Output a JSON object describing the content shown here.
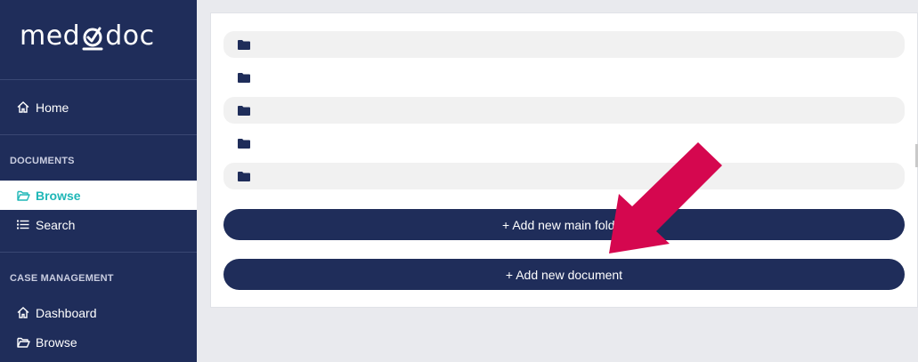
{
  "brand": {
    "logo_text_left": "med",
    "logo_text_right": "doc"
  },
  "sidebar": {
    "home": {
      "label": "Home",
      "icon": "home-icon"
    },
    "documents_section": "DOCUMENTS",
    "documents_items": [
      {
        "label": "Browse",
        "icon": "folder-open-icon",
        "active": true
      },
      {
        "label": "Search",
        "icon": "list-icon",
        "active": false
      }
    ],
    "case_section": "CASE MANAGEMENT",
    "case_items": [
      {
        "label": "Dashboard",
        "icon": "home-icon"
      },
      {
        "label": "Browse",
        "icon": "folder-open-icon"
      }
    ]
  },
  "main": {
    "folders": [
      {
        "name": ""
      },
      {
        "name": ""
      },
      {
        "name": ""
      },
      {
        "name": ""
      },
      {
        "name": ""
      }
    ],
    "add_main_folder_label": "+ Add new main folder",
    "add_document_label": "+ Add new document"
  },
  "colors": {
    "sidebar_bg": "#1f2d5a",
    "active_accent": "#1fb7b7",
    "button_bg": "#1f2d5a",
    "arrow": "#d5074f"
  }
}
